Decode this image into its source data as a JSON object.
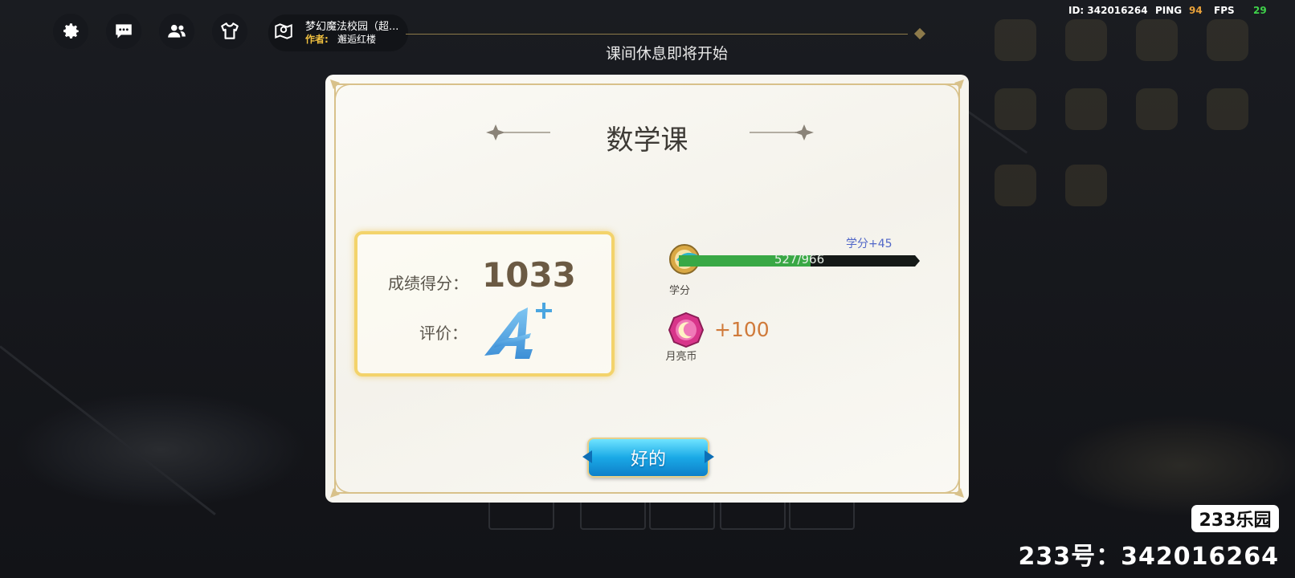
{
  "hud": {
    "map_name": "梦幻魔法校园（超...",
    "author_label": "作者:",
    "author_name": "邂逅红楼",
    "notice": "课间休息即将开始",
    "id_text": "ID: 342016264",
    "ping_label": "PING",
    "ping_value": "94",
    "fps_label": "FPS",
    "fps_value": "29",
    "buttons": [
      "gear-icon",
      "chat-icon",
      "friends-icon",
      "outfit-icon",
      "map-pin-icon"
    ]
  },
  "dialog": {
    "title": "数学课",
    "score_label": "成绩得分：",
    "score_value": "1033",
    "grade_label": "评价：",
    "grade": "A+",
    "credit": {
      "gain": "学分+45",
      "progress_text": "527/966",
      "progress_fraction": 0.5455,
      "label": "学分"
    },
    "coin": {
      "value": "+100",
      "label": "月亮币"
    },
    "ok_label": "好的"
  },
  "watermark": {
    "logo": "233乐园",
    "account": "233号：342016264"
  },
  "colors": {
    "gold": "#f3d36b",
    "progress_green": "#39a845",
    "button_blue": "#1aa9e6",
    "ping_color": "#e8a13a",
    "fps_color": "#3fd24a"
  }
}
